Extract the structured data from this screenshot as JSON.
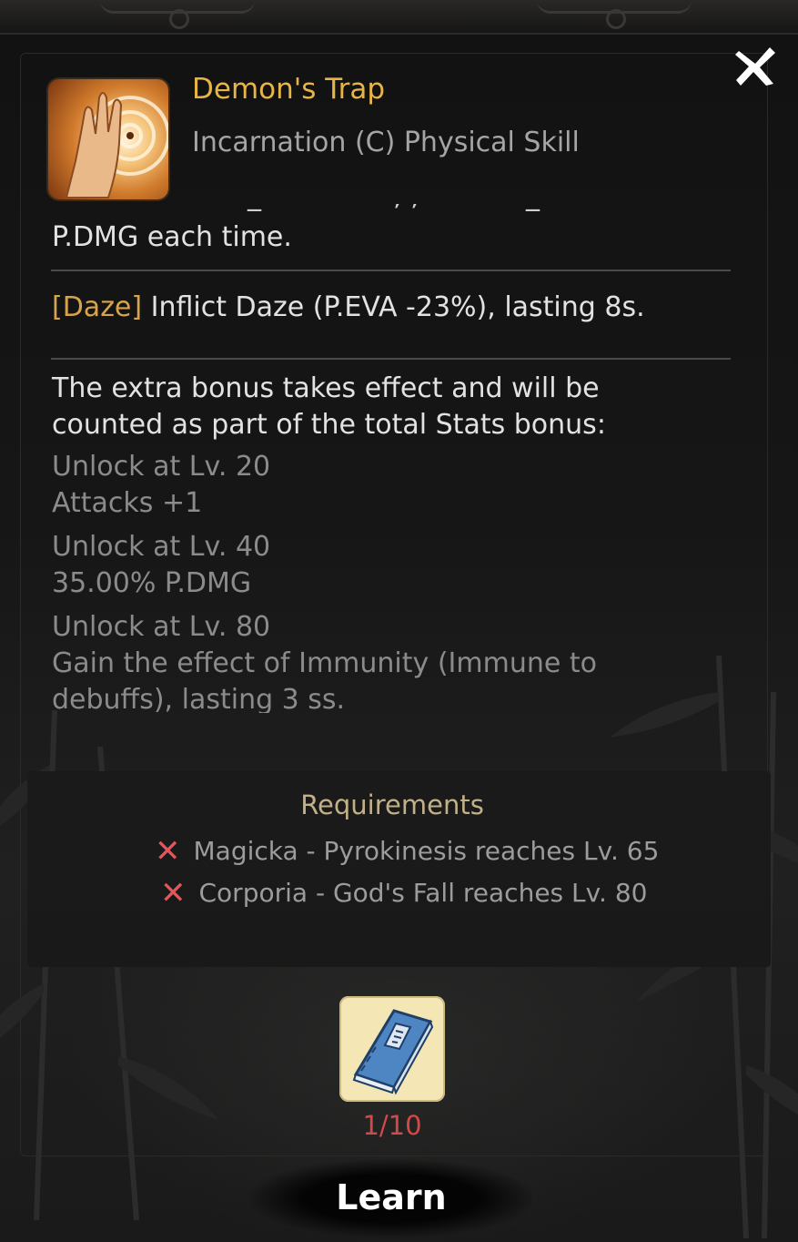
{
  "skill": {
    "name": "Demon's Trap",
    "type": "Incarnation (C) Physical Skill"
  },
  "description": {
    "partial_line": "P.DMG each time.",
    "daze_tag": "[Daze]",
    "daze_text": " Inflict Daze (P.EVA -23%), lasting 8s.",
    "bonus_intro_line1": "The extra bonus takes effect and will be",
    "bonus_intro_line2": "counted as part of the total Stats bonus:",
    "unlocks": [
      {
        "level": "Unlock at Lv. 20",
        "effect": "Attacks +1"
      },
      {
        "level": "Unlock at Lv. 40",
        "effect": "35.00% P.DMG"
      },
      {
        "level": "Unlock at Lv. 80",
        "effect_line1": "Gain the effect of Immunity (Immune to",
        "effect_line2": "debuffs), lasting 3 ss."
      }
    ]
  },
  "requirements": {
    "title": "Requirements",
    "items": [
      "Magicka - Pyrokinesis reaches Lv. 65",
      "Corporia - God's Fall reaches Lv. 80"
    ]
  },
  "book": {
    "count": "1/10"
  },
  "learn_button": "Learn",
  "colors": {
    "title_gold": "#e7b547",
    "tag_gold": "#d7a44c",
    "requirement_x": "#e3555a",
    "count_red": "#d14a4a"
  }
}
